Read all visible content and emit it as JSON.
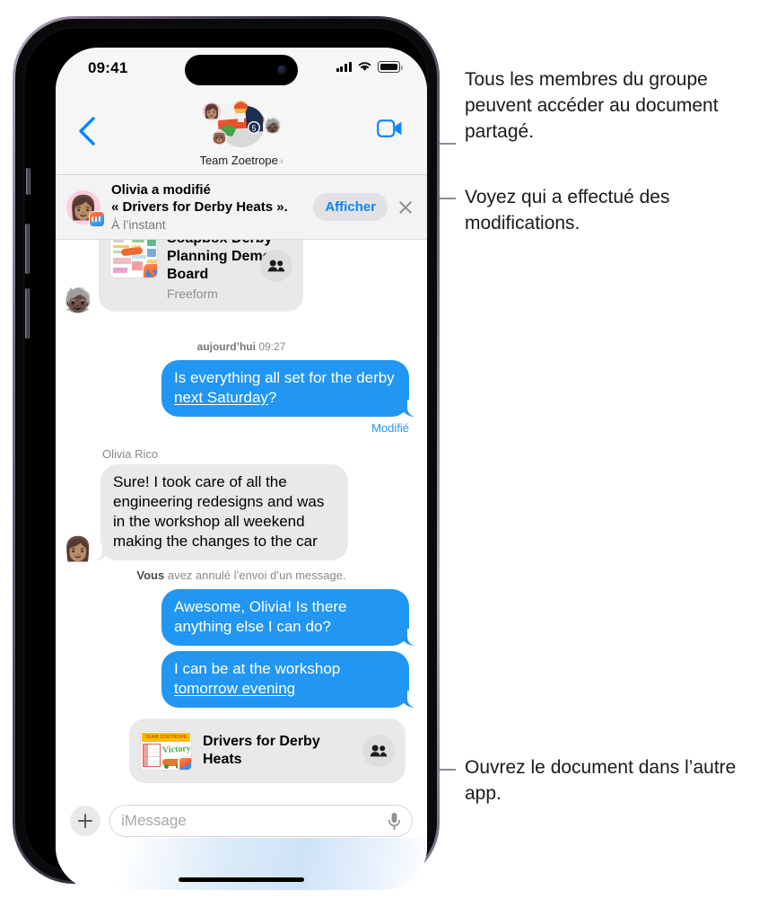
{
  "status_bar": {
    "time": "09:41",
    "signal_icon": "cellular-bars-icon",
    "wifi_icon": "wifi-icon",
    "battery_icon": "battery-icon"
  },
  "nav_bar": {
    "back_icon": "back-chevron-icon",
    "facetime_icon": "video-camera-icon",
    "group_name": "Team Zoetrope",
    "group_chevron": "›",
    "group_avatar_icon": "group-avatar-soapbox-car",
    "member_avatars": [
      "memoji-olivia",
      "memoji-bear",
      "memoji-hat-person"
    ]
  },
  "banner": {
    "avatar_icon": "memoji-olivia-avatar",
    "app_badge_icon": "freeform-app-badge-icon",
    "line1": "Olivia a modifié",
    "line2": "« Drivers for Derby Heats ».",
    "line3": "À l’instant",
    "view_button": "Afficher",
    "close_icon": "close-icon",
    "accent_color": "#0a84ff"
  },
  "conversation": {
    "top_card": {
      "title": "Soapbox Derby Planning Demo Board",
      "subtitle": "Freeform",
      "thumbnail_icon": "freeform-board-thumbnail",
      "shared_icon": "two-people-icon",
      "sender_avatar_icon": "memoji-hat-person-avatar"
    },
    "timestamp": {
      "day": "aujourd’hui",
      "time": "09:27"
    },
    "messages": [
      {
        "side": "out",
        "text_before": "Is everything all set for the derby ",
        "text_link": "next Saturday",
        "text_after": "?",
        "edited_label": "Modifié"
      },
      {
        "side": "in",
        "sender": "Olivia Rico",
        "text": "Sure! I took care of all the engineering redesigns and was in the workshop all weekend making the changes to the car",
        "avatar_icon": "memoji-olivia-avatar"
      }
    ],
    "unsent_notice": {
      "bold": "Vous",
      "rest": " avez annulé l’envoi d’un message."
    },
    "messages2": [
      {
        "side": "out",
        "text": "Awesome, Olivia! Is there anything else I can do?"
      },
      {
        "side": "out",
        "text_before": "I can be at the workshop ",
        "text_link": "tomorrow evening",
        "text_after": ""
      }
    ],
    "bottom_card": {
      "title": "Drivers for Derby Heats",
      "thumbnail_icon": "derby-heats-thumbnail",
      "thumbnail_header": "TEAM ZOETROPE",
      "thumbnail_word": "Victory!",
      "shared_icon": "two-people-icon"
    }
  },
  "input_bar": {
    "add_icon": "plus-icon",
    "placeholder": "iMessage",
    "mic_icon": "microphone-icon",
    "home_indicator": "home-indicator"
  },
  "callouts": [
    {
      "text": "Tous les membres du groupe peuvent accéder au document partagé."
    },
    {
      "text": "Voyez qui a effectué des modifications."
    },
    {
      "text": "Ouvrez le document dans l’autre app."
    }
  ]
}
